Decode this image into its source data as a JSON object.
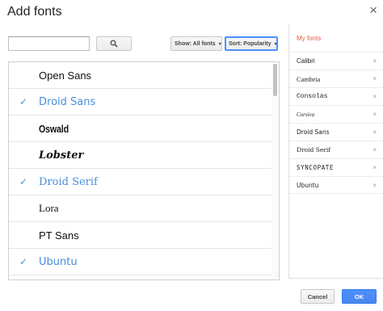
{
  "dialog": {
    "title": "Add fonts",
    "close_glyph": "×"
  },
  "search": {
    "value": "",
    "placeholder": "",
    "button_icon": "search-icon"
  },
  "filters": {
    "show_label": "Show: All fonts",
    "sort_label": "Sort: Popularity",
    "caret": "▾"
  },
  "font_list": [
    {
      "name": "Open Sans",
      "selected": false
    },
    {
      "name": "Droid Sans",
      "selected": true
    },
    {
      "name": "Oswald",
      "selected": false
    },
    {
      "name": "Lobster",
      "selected": false
    },
    {
      "name": "Droid Serif",
      "selected": true
    },
    {
      "name": "Lora",
      "selected": false
    },
    {
      "name": "PT Sans",
      "selected": false
    },
    {
      "name": "Ubuntu",
      "selected": true
    }
  ],
  "check_glyph": "✓",
  "my_fonts": {
    "title": "My fonts",
    "remove_glyph": "×",
    "items": [
      "Calibri",
      "Cambria",
      "Consolas",
      "Corsiva",
      "Droid Sans",
      "Droid Serif",
      "SYNCOPATE",
      "Ubuntu"
    ]
  },
  "actions": {
    "cancel": "Cancel",
    "ok": "OK"
  },
  "colors": {
    "accent_blue": "#4a8ddc",
    "my_fonts_title": "#e25e3a",
    "ok_button": "#4d90fe"
  }
}
